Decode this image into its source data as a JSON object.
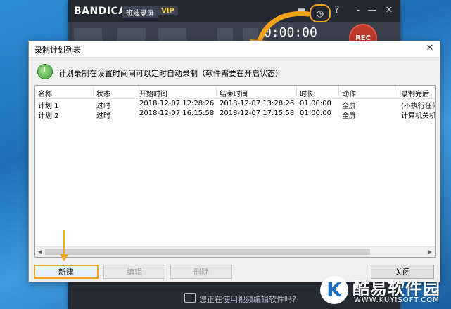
{
  "bandicam": {
    "logo": "BANDICAM",
    "cn_badge": "班迪录屏",
    "vip": "VIP",
    "timer": "0:00:00",
    "rec_label": "REC",
    "help": "?",
    "minimize": "-",
    "restore": "—",
    "close": "✕",
    "bottom_text": "您正在使用视频编辑软件吗?"
  },
  "dialog": {
    "title": "录制计划列表",
    "header_text": "计划录制在设置时间间可以定时自动录制（软件需要在开启状态）",
    "columns": [
      "名称",
      "状态",
      "开始时间",
      "结束时间",
      "时长",
      "动作",
      "录制完后"
    ],
    "rows": [
      [
        "计划 1",
        "过时",
        "2018-12-07 12:28:26",
        "2018-12-07 13:28:26",
        "01:00:00",
        "全屏",
        "(不执行任何"
      ],
      [
        "计划 2",
        "过时",
        "2018-12-07 16:15:58",
        "2018-12-07 17:15:58",
        "01:00:00",
        "全屏",
        "计算机关机"
      ]
    ],
    "buttons": {
      "new": "新建",
      "edit": "编辑",
      "delete": "删除",
      "close": "关闭"
    }
  },
  "watermark": {
    "letter": "K",
    "name": "酷易软件园",
    "url": "WWW.KUYISOFT.COM"
  },
  "colors": {
    "highlight": "#f2a31c",
    "rec": "#c0392b",
    "bandicam_bg": "#2a2f3a"
  }
}
